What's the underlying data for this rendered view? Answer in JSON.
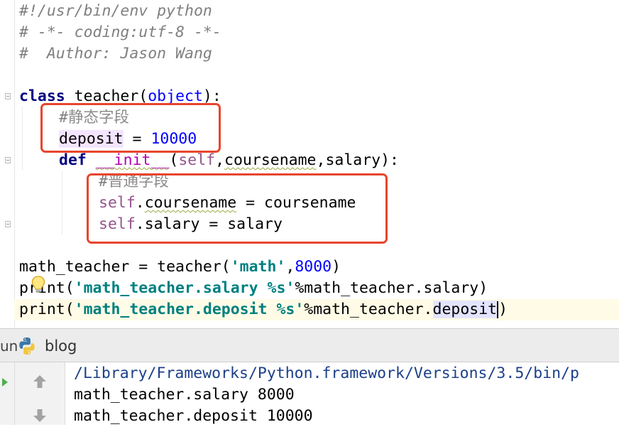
{
  "editor": {
    "comments": {
      "shebang": "#!/usr/bin/env python",
      "coding": "# -*- coding:utf-8 -*-",
      "author": "#  Author: Jason Wang",
      "static_prefix": "#",
      "static_text": "静态字段",
      "instance_prefix": "#",
      "instance_text": "普通字段"
    },
    "code": {
      "kw_class": "class",
      "class_name": " teacher(",
      "kw_object": "object",
      "class_close": "):",
      "deposit_name": "deposit",
      "deposit_eq": " = ",
      "deposit_value": "10000",
      "kw_def": "def",
      "space": " ",
      "init_name": "__init__",
      "init_open": "(",
      "self_kw": "self",
      "init_params_a": ",",
      "param_coursename": "coursename",
      "init_params_b": ",salary):",
      "dot": ".",
      "attr_coursename": "coursename",
      "assign_coursename": " = coursename",
      "attr_salary": "salary",
      "assign_salary": " = salary",
      "math_teacher_lhs": "math_teacher = teacher(",
      "str_math": "'math'",
      "comma": ",",
      "num_8000": "8000",
      "close_paren": ")",
      "print_kw": "print(",
      "str_salary": "'math_teacher.salary %s'",
      "salary_rest": "%math_teacher.salary)",
      "str_deposit": "'math_teacher.deposit %s'",
      "deposit_rest_a": "%math_teacher.",
      "deposit_attr": "deposit",
      "deposit_rest_b": ")"
    },
    "accent_colors": {
      "annotation_box": "#e8452c",
      "keyword": "#000080",
      "number": "#0000ff",
      "string": "#008080",
      "self": "#94558d"
    }
  },
  "runbar": {
    "run_label": "un",
    "tab_label": "blog",
    "icon": "python-icon"
  },
  "console": {
    "lines": [
      "/Library/Frameworks/Python.framework/Versions/3.5/bin/p",
      "math_teacher.salary 8000",
      "math_teacher.deposit 10000"
    ],
    "tools": [
      "arrow-up-icon",
      "arrow-down-icon"
    ]
  }
}
